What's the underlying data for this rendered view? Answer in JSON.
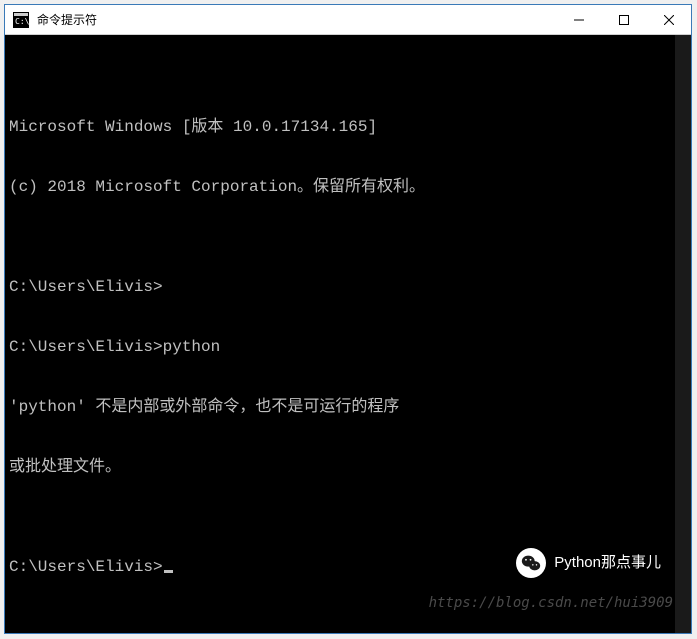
{
  "window": {
    "title": "命令提示符"
  },
  "terminal": {
    "lines": [
      "Microsoft Windows [版本 10.0.17134.165]",
      "(c) 2018 Microsoft Corporation。保留所有权利。",
      "",
      "C:\\Users\\Elivis>",
      "C:\\Users\\Elivis>python",
      "'python' 不是内部或外部命令，也不是可运行的程序",
      "或批处理文件。",
      "",
      "C:\\Users\\Elivis>"
    ]
  },
  "badge": {
    "text": "Python那点事儿"
  },
  "watermark": {
    "text": "https://blog.csdn.net/hui3909"
  }
}
